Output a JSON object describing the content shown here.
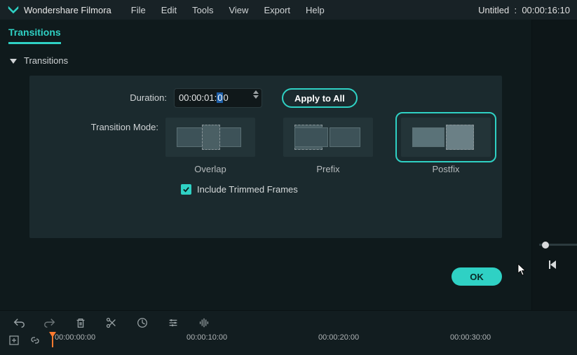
{
  "app": {
    "title": "Wondershare Filmora"
  },
  "menu": {
    "file": "File",
    "edit": "Edit",
    "tools": "Tools",
    "view": "View",
    "export": "Export",
    "help": "Help"
  },
  "project": {
    "name": "Untitled",
    "time": "00:00:16:10"
  },
  "tab": {
    "transitions": "Transitions"
  },
  "section": {
    "title": "Transitions"
  },
  "fields": {
    "duration_label": "Duration:",
    "duration_value_prefix": "00:00:01:",
    "duration_value_sel": "0",
    "duration_value_suffix": "0",
    "apply_all": "Apply to All",
    "mode_label": "Transition Mode:",
    "modes": {
      "overlap": "Overlap",
      "prefix": "Prefix",
      "postfix": "Postfix"
    },
    "include_trimmed": "Include Trimmed Frames"
  },
  "buttons": {
    "ok": "OK"
  },
  "timeline": {
    "ticks": [
      "00:00:00:00",
      "00:00:10:00",
      "00:00:20:00",
      "00:00:30:00"
    ]
  }
}
